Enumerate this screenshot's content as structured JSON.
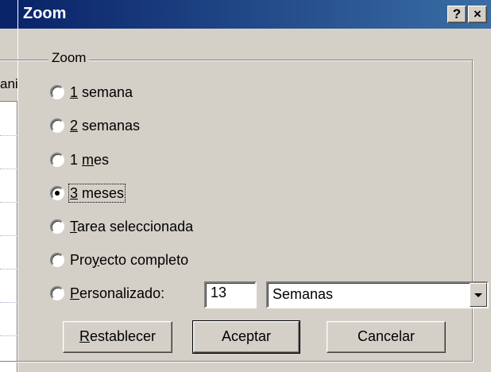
{
  "background_app": {
    "header_fragment": "ani"
  },
  "dialog": {
    "title": "Zoom",
    "help_label": "?",
    "close_label": "×"
  },
  "group": {
    "legend": "Zoom"
  },
  "options": [
    {
      "mnemonic": "1",
      "rest": " semana",
      "prefix": "",
      "checked": false
    },
    {
      "mnemonic": "2",
      "rest": " semanas",
      "prefix": "",
      "checked": false
    },
    {
      "prefix": "1 ",
      "mnemonic": "m",
      "rest": "es",
      "checked": false
    },
    {
      "mnemonic": "3",
      "rest": " meses",
      "prefix": "",
      "checked": true
    },
    {
      "mnemonic": "T",
      "rest": "area seleccionada",
      "prefix": "",
      "checked": false
    },
    {
      "prefix": "Pro",
      "mnemonic": "y",
      "rest": "ecto completo",
      "checked": false
    },
    {
      "mnemonic": "P",
      "rest": "ersonalizado:",
      "prefix": "",
      "checked": false
    }
  ],
  "custom": {
    "number_value": "13",
    "unit_value": "Semanas"
  },
  "buttons": {
    "reset_mnemonic": "R",
    "reset_rest": "establecer",
    "ok_label": "Aceptar",
    "cancel_label": "Cancelar"
  }
}
